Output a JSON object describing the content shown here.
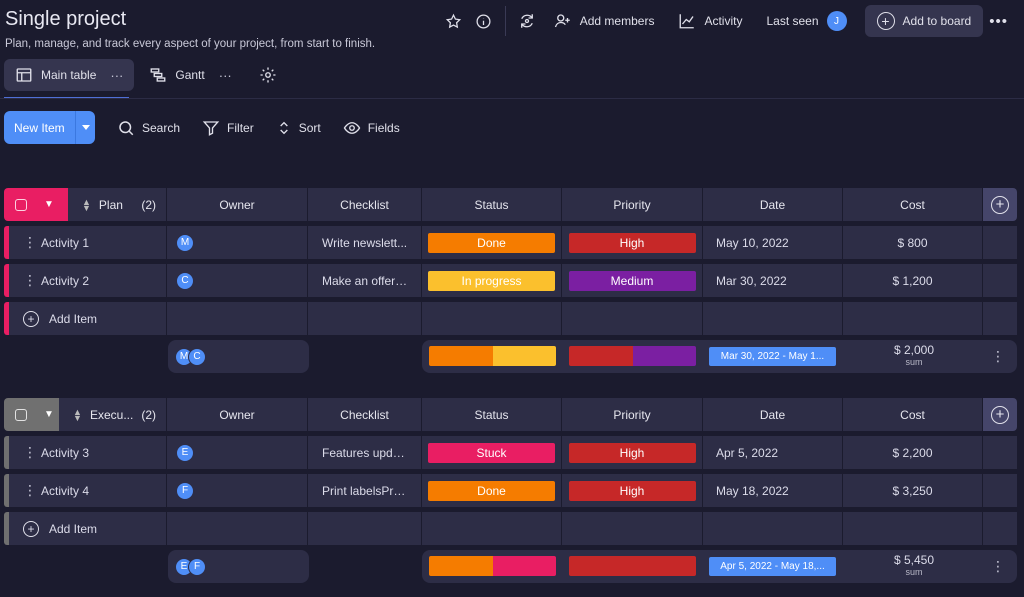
{
  "header": {
    "title": "Single project",
    "subtitle": "Plan, manage, and track every aspect of your project, from start to finish.",
    "add_members": "Add members",
    "activity": "Activity",
    "last_seen": "Last seen",
    "last_seen_user": "J",
    "add_to_board": "Add to board"
  },
  "tabs": [
    {
      "label": "Main table",
      "icon": "table-icon",
      "active": true
    },
    {
      "label": "Gantt",
      "icon": "gantt-icon",
      "active": false
    }
  ],
  "tab_more": "···",
  "toolbar": {
    "new_item": "New Item",
    "search": "Search",
    "filter": "Filter",
    "sort": "Sort",
    "fields": "Fields"
  },
  "columns": {
    "owner": "Owner",
    "checklist": "Checklist",
    "status": "Status",
    "priority": "Priority",
    "date": "Date",
    "cost": "Cost"
  },
  "colors": {
    "accent": "#4f8ef7",
    "plan": "#e91e63",
    "execution": "#707070",
    "done": "#f57c00",
    "in_progress": "#fbc02d",
    "stuck": "#e91e63",
    "high": "#c62828",
    "medium": "#7b1fa2"
  },
  "groups": [
    {
      "name": "Plan",
      "count": "(2)",
      "items": [
        {
          "name": "Activity 1",
          "owner": "M",
          "checklist": "Write newslett...",
          "status": "Done",
          "priority": "High",
          "date": "May 10, 2022",
          "cost": "$ 800"
        },
        {
          "name": "Activity 2",
          "owner": "C",
          "checklist": "Make an offerO...",
          "status": "In progress",
          "priority": "Medium",
          "date": "Mar 30, 2022",
          "cost": "$ 1,200"
        }
      ],
      "add_item": "Add Item",
      "summary": {
        "owners": [
          "M",
          "C"
        ],
        "date_range": "Mar 30, 2022 - May 1...",
        "cost": "$ 2,000",
        "cost_label": "sum",
        "status_split": [
          0.5,
          0.5
        ],
        "priority_split": [
          0.5,
          0.5
        ]
      }
    },
    {
      "name": "Execu...",
      "count": "(2)",
      "items": [
        {
          "name": "Activity 3",
          "owner": "E",
          "checklist": "Features updat...",
          "status": "Stuck",
          "priority": "High",
          "date": "Apr 5, 2022",
          "cost": "$ 2,200"
        },
        {
          "name": "Activity 4",
          "owner": "F",
          "checklist": "Print labelsPro...",
          "status": "Done",
          "priority": "High",
          "date": "May 18, 2022",
          "cost": "$ 3,250"
        }
      ],
      "add_item": "Add Item",
      "summary": {
        "owners": [
          "E",
          "F"
        ],
        "date_range": "Apr 5, 2022 - May 18,...",
        "cost": "$ 5,450",
        "cost_label": "sum",
        "status_split": [
          0.5,
          0.5
        ],
        "priority_split": [
          1.0
        ]
      }
    }
  ]
}
